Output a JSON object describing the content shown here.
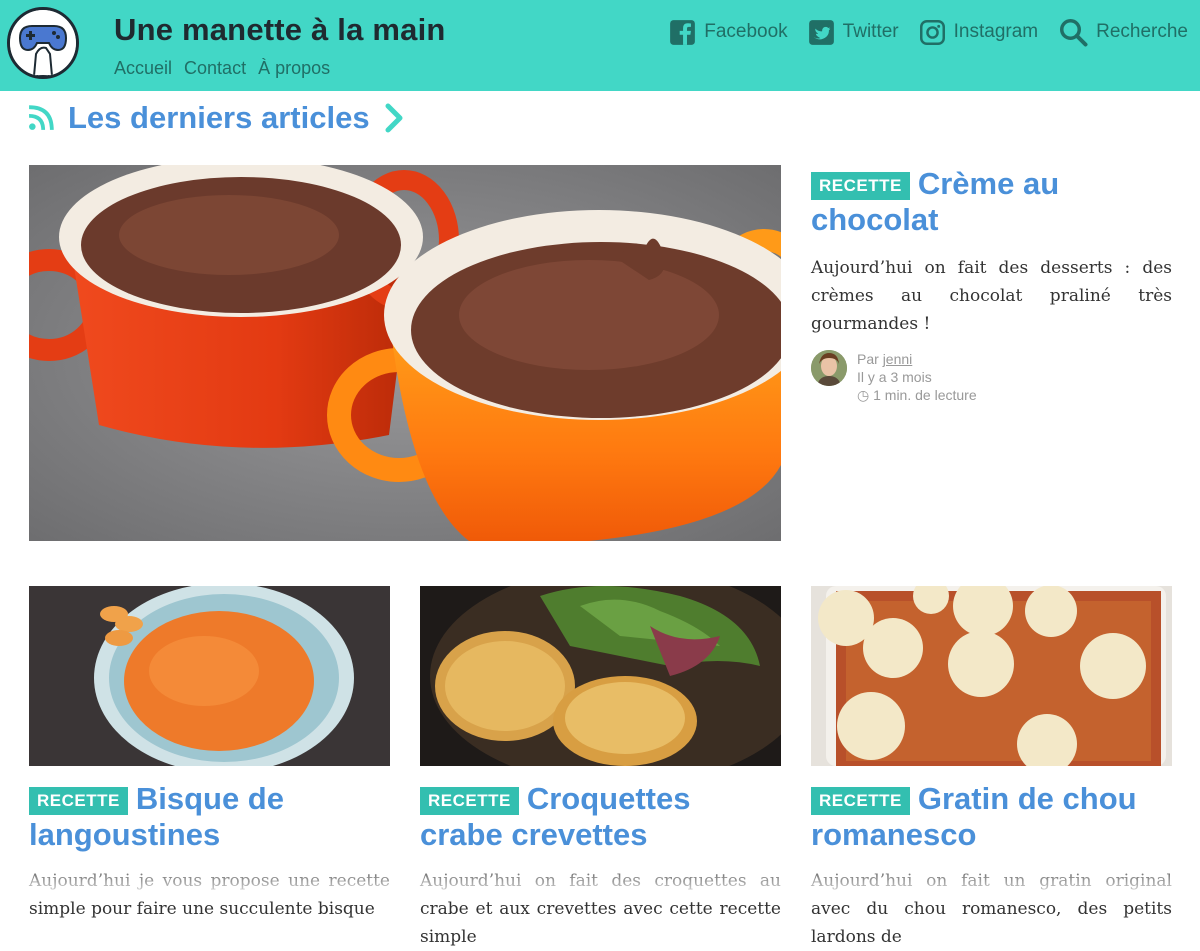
{
  "header": {
    "site_title": "Une manette à la main",
    "nav": [
      "Accueil",
      "Contact",
      "À propos"
    ],
    "social": [
      {
        "label": "Facebook",
        "icon": "facebook-icon"
      },
      {
        "label": "Twitter",
        "icon": "twitter-icon"
      },
      {
        "label": "Instagram",
        "icon": "instagram-icon"
      },
      {
        "label": "Recherche",
        "icon": "search-icon"
      }
    ],
    "colors": {
      "background": "#42d7c6",
      "text": "#206f66"
    }
  },
  "section": {
    "title": "Les derniers articles",
    "icon": "rss-icon",
    "arrow_icon": "chevron-right-icon"
  },
  "featured": {
    "category": "RECETTE",
    "title": "Crème au chocolat",
    "excerpt": "Aujourd’hui on fait des desserts : des crèmes au chocolat praliné très gourmandes !",
    "author_prefix": "Par",
    "author": "jenni",
    "date": "Il y a 3 mois",
    "reading_time": "1 min. de lecture",
    "image_alt": "chocolate cream in two ramekins"
  },
  "cards": [
    {
      "category": "RECETTE",
      "title": "Bisque de langoustines",
      "excerpt": "Aujourd’hui je vous propose une recette simple pour faire une succulente bisque"
    },
    {
      "category": "RECETTE",
      "title": "Croquettes crabe crevettes",
      "excerpt": "Aujourd’hui on fait des croquettes au crabe et aux crevettes avec cette recette simple"
    },
    {
      "category": "RECETTE",
      "title": "Gratin de chou romanesco",
      "excerpt": "Aujourd’hui on fait un gratin original avec du chou romanesco, des petits lardons de"
    }
  ],
  "colors": {
    "accent": "#4a90d9",
    "badge": "#33bfb0"
  }
}
